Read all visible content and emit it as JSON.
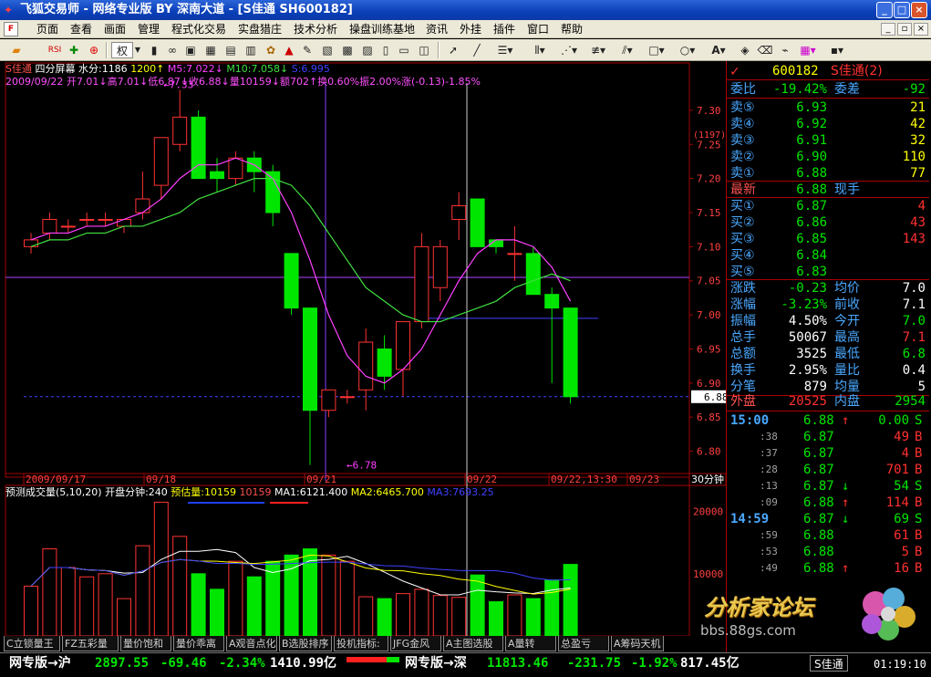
{
  "window": {
    "title": "飞狐交易师 - 网络专业版 BY 深南大道 - [S佳通 SH600182]",
    "min": "_",
    "max": "□",
    "close": "×"
  },
  "menu": {
    "items": [
      "页面",
      "查看",
      "画面",
      "管理",
      "程式化交易",
      "实盘猎庄",
      "技术分析",
      "操盘训练基地",
      "资讯",
      "外挂",
      "插件",
      "窗口",
      "帮助"
    ],
    "sys_min": "_",
    "sys_restore": "▫",
    "sys_close": "×"
  },
  "toolbar": {
    "rights_label": "权",
    "letter_A": "A"
  },
  "chart_header": {
    "stock": "S佳通",
    "period_mode": "四分屏幕",
    "water": "水分:1186",
    "ma_base": "1200↑",
    "ma5": "M5:7.022↓",
    "ma10": "M10:7.058↓",
    "ma_x": "S:6.995",
    "line2": "2009/09/22 开7.01↓高7.01↓低6.87↓收6.88↓量10159↓额702↑换0.60%振2.00%涨(-0.13)-1.85%"
  },
  "price_axis": {
    "labels": [
      "7.30",
      "7.25",
      "7.20",
      "7.15",
      "7.10",
      "7.05",
      "7.00",
      "6.95",
      "6.90",
      "6.85",
      "6.80"
    ],
    "extra": "(1197)",
    "current": "6.88"
  },
  "annotations": {
    "high": "7.33",
    "low": "6.78"
  },
  "date_axis": {
    "labels": [
      "2009/09/17",
      "09/18",
      "09/21",
      "09/22",
      "09/22,13:30",
      "09/23"
    ],
    "period": "30分钟"
  },
  "vol_header": {
    "title": "预测成交量(5,10,20)",
    "open_min": "开盘分钟:240",
    "forecast": "预估量:10159",
    "vol": "10159",
    "ma1": "MA1:6121.400",
    "ma2": "MA2:6465.700",
    "ma3": "MA3:7693.25"
  },
  "vol_axis": {
    "labels": [
      "20000",
      "10000"
    ]
  },
  "chart_data": {
    "type": "bar",
    "title": "",
    "candles_ohlc": [
      [
        7.1,
        7.12,
        7.09,
        7.11
      ],
      [
        7.12,
        7.15,
        7.11,
        7.14
      ],
      [
        7.13,
        7.14,
        7.12,
        7.13
      ],
      [
        7.14,
        7.15,
        7.13,
        7.14
      ],
      [
        7.14,
        7.15,
        7.13,
        7.14
      ],
      [
        7.13,
        7.14,
        7.12,
        7.14
      ],
      [
        7.15,
        7.21,
        7.14,
        7.17
      ],
      [
        7.19,
        7.24,
        7.17,
        7.26
      ],
      [
        7.25,
        7.33,
        7.24,
        7.29
      ],
      [
        7.29,
        7.3,
        7.2,
        7.2
      ],
      [
        7.21,
        7.23,
        7.18,
        7.2
      ],
      [
        7.2,
        7.24,
        7.19,
        7.23
      ],
      [
        7.23,
        7.24,
        7.18,
        7.21
      ],
      [
        7.21,
        7.22,
        7.13,
        7.15
      ],
      [
        7.09,
        7.09,
        7.0,
        7.01
      ],
      [
        7.01,
        7.01,
        6.78,
        6.86
      ],
      [
        6.86,
        6.89,
        6.85,
        6.89
      ],
      [
        6.88,
        6.89,
        6.87,
        6.88
      ],
      [
        6.89,
        6.98,
        6.86,
        6.96
      ],
      [
        6.95,
        6.97,
        6.89,
        6.91
      ],
      [
        6.92,
        6.99,
        6.88,
        6.99
      ],
      [
        6.99,
        7.12,
        6.98,
        7.1
      ],
      [
        7.04,
        7.11,
        7.02,
        7.1
      ],
      [
        7.14,
        7.18,
        7.11,
        7.16
      ],
      [
        7.17,
        7.17,
        7.1,
        7.1
      ],
      [
        7.11,
        7.11,
        7.09,
        7.1
      ],
      [
        7.09,
        7.13,
        7.05,
        7.09
      ],
      [
        7.09,
        7.1,
        7.03,
        7.03
      ],
      [
        7.03,
        7.04,
        6.9,
        7.01
      ],
      [
        7.01,
        7.01,
        6.87,
        6.88
      ]
    ],
    "volumes": [
      8000,
      14000,
      11000,
      9500,
      10000,
      6000,
      14500,
      21500,
      16000,
      10000,
      7500,
      12000,
      9500,
      12000,
      13000,
      14000,
      13000,
      12000,
      6300,
      6000,
      6800,
      7500,
      6500,
      6200,
      9800,
      5500,
      6600,
      6000,
      9000,
      11500
    ],
    "ma5": [
      7.11,
      7.12,
      7.12,
      7.13,
      7.13,
      7.14,
      7.15,
      7.17,
      7.2,
      7.22,
      7.22,
      7.23,
      7.22,
      7.2,
      7.15,
      7.08,
      7.0,
      6.94,
      6.91,
      6.9,
      6.92,
      6.95,
      7.0,
      7.05,
      7.09,
      7.11,
      7.11,
      7.1,
      7.07,
      7.02
    ],
    "ma10": [
      7.1,
      7.11,
      7.11,
      7.12,
      7.12,
      7.13,
      7.13,
      7.14,
      7.15,
      7.17,
      7.18,
      7.19,
      7.2,
      7.2,
      7.19,
      7.16,
      7.12,
      7.08,
      7.04,
      7.02,
      7.0,
      6.99,
      6.99,
      7.0,
      7.01,
      7.02,
      7.04,
      7.05,
      7.06,
      7.05
    ],
    "ylim": [
      6.77,
      7.34
    ],
    "vol_ylim": [
      0,
      22000
    ],
    "grid": false,
    "colors": {
      "up": "#ff3232",
      "down": "#00e600",
      "ma5": "#ff40ff",
      "ma10": "#40e040",
      "vma1": "#ffffff",
      "vma2": "#ffff00",
      "vma3": "#4040ff"
    }
  },
  "quote": {
    "code": "600182",
    "name": "S佳通(2)",
    "weibi_label": "委比",
    "weibi": "-19.42%",
    "weicha_label": "委差",
    "weicha": "-92",
    "asks": [
      {
        "label": "卖⑤",
        "price": "6.93",
        "vol": "21"
      },
      {
        "label": "卖④",
        "price": "6.92",
        "vol": "42"
      },
      {
        "label": "卖③",
        "price": "6.91",
        "vol": "32"
      },
      {
        "label": "卖②",
        "price": "6.90",
        "vol": "110"
      },
      {
        "label": "卖①",
        "price": "6.88",
        "vol": "77"
      }
    ],
    "last_label": "最新",
    "last": "6.88",
    "now_hand": "现手",
    "bids": [
      {
        "label": "买①",
        "price": "6.87",
        "vol": "4"
      },
      {
        "label": "买②",
        "price": "6.86",
        "vol": "43"
      },
      {
        "label": "买③",
        "price": "6.85",
        "vol": "143"
      },
      {
        "label": "买④",
        "price": "6.84",
        "vol": ""
      },
      {
        "label": "买⑤",
        "price": "6.83",
        "vol": ""
      }
    ],
    "stats": [
      {
        "l1": "涨跌",
        "v1": "-0.23",
        "l2": "均价",
        "v2": "7.0"
      },
      {
        "l1": "涨幅",
        "v1": "-3.23%",
        "l2": "前收",
        "v2": "7.1"
      },
      {
        "l1": "振幅",
        "v1": "4.50%",
        "l2": "今开",
        "v2": "7.0"
      },
      {
        "l1": "总手",
        "v1": "50067",
        "l2": "最高",
        "v2": "7.1"
      },
      {
        "l1": "总额",
        "v1": "3525",
        "l2": "最低",
        "v2": "6.8"
      },
      {
        "l1": "换手",
        "v1": "2.95%",
        "l2": "量比",
        "v2": "0.4"
      },
      {
        "l1": "分笔",
        "v1": "879",
        "l2": "均量",
        "v2": "5"
      }
    ],
    "outer_label": "外盘",
    "outer": "20525",
    "inner_label": "内盘",
    "inner": "2954",
    "ticks": [
      {
        "t": "15:00",
        "p": "6.88",
        "a": "↑",
        "v": "0.00",
        "s": "S"
      },
      {
        "t": ":38",
        "p": "6.87",
        "a": "",
        "v": "49",
        "s": "B"
      },
      {
        "t": ":37",
        "p": "6.87",
        "a": "",
        "v": "4",
        "s": "B"
      },
      {
        "t": ":28",
        "p": "6.87",
        "a": "",
        "v": "701",
        "s": "B"
      },
      {
        "t": ":13",
        "p": "6.87",
        "a": "↓",
        "v": "54",
        "s": "S"
      },
      {
        "t": ":09",
        "p": "6.88",
        "a": "↑",
        "v": "114",
        "s": "B"
      },
      {
        "t": "14:59",
        "p": "6.87",
        "a": "↓",
        "v": "69",
        "s": "S"
      },
      {
        "t": ":59",
        "p": "6.88",
        "a": "",
        "v": "61",
        "s": "B"
      },
      {
        "t": ":53",
        "p": "6.88",
        "a": "",
        "v": "5",
        "s": "B"
      },
      {
        "t": ":49",
        "p": "6.88",
        "a": "↑",
        "v": "16",
        "s": "B"
      }
    ]
  },
  "tabs": [
    "C立锁量王",
    "FZ五彩量",
    "量价饱和",
    "量价乖离",
    "A观音点化",
    "B选股排序",
    "投机指标:",
    "JFG金风",
    "A主图选股",
    "A量转",
    "总盈亏",
    "A筹码天机"
  ],
  "status": {
    "sh_label": "网专版→沪",
    "sh_index": "2897.55",
    "sh_change": "-69.46",
    "sh_pct": "-2.34%",
    "sh_amount": "1410.99亿",
    "sz_label": "网专版→深",
    "sz_index": "11813.46",
    "sz_change": "-231.75",
    "sz_pct": "-1.92%",
    "sz_amount": "817.45亿",
    "stock_tab": "S佳通",
    "clock": "01:19:10"
  },
  "watermark": {
    "text": "分析家论坛",
    "url": "bbs.88gs.com"
  }
}
